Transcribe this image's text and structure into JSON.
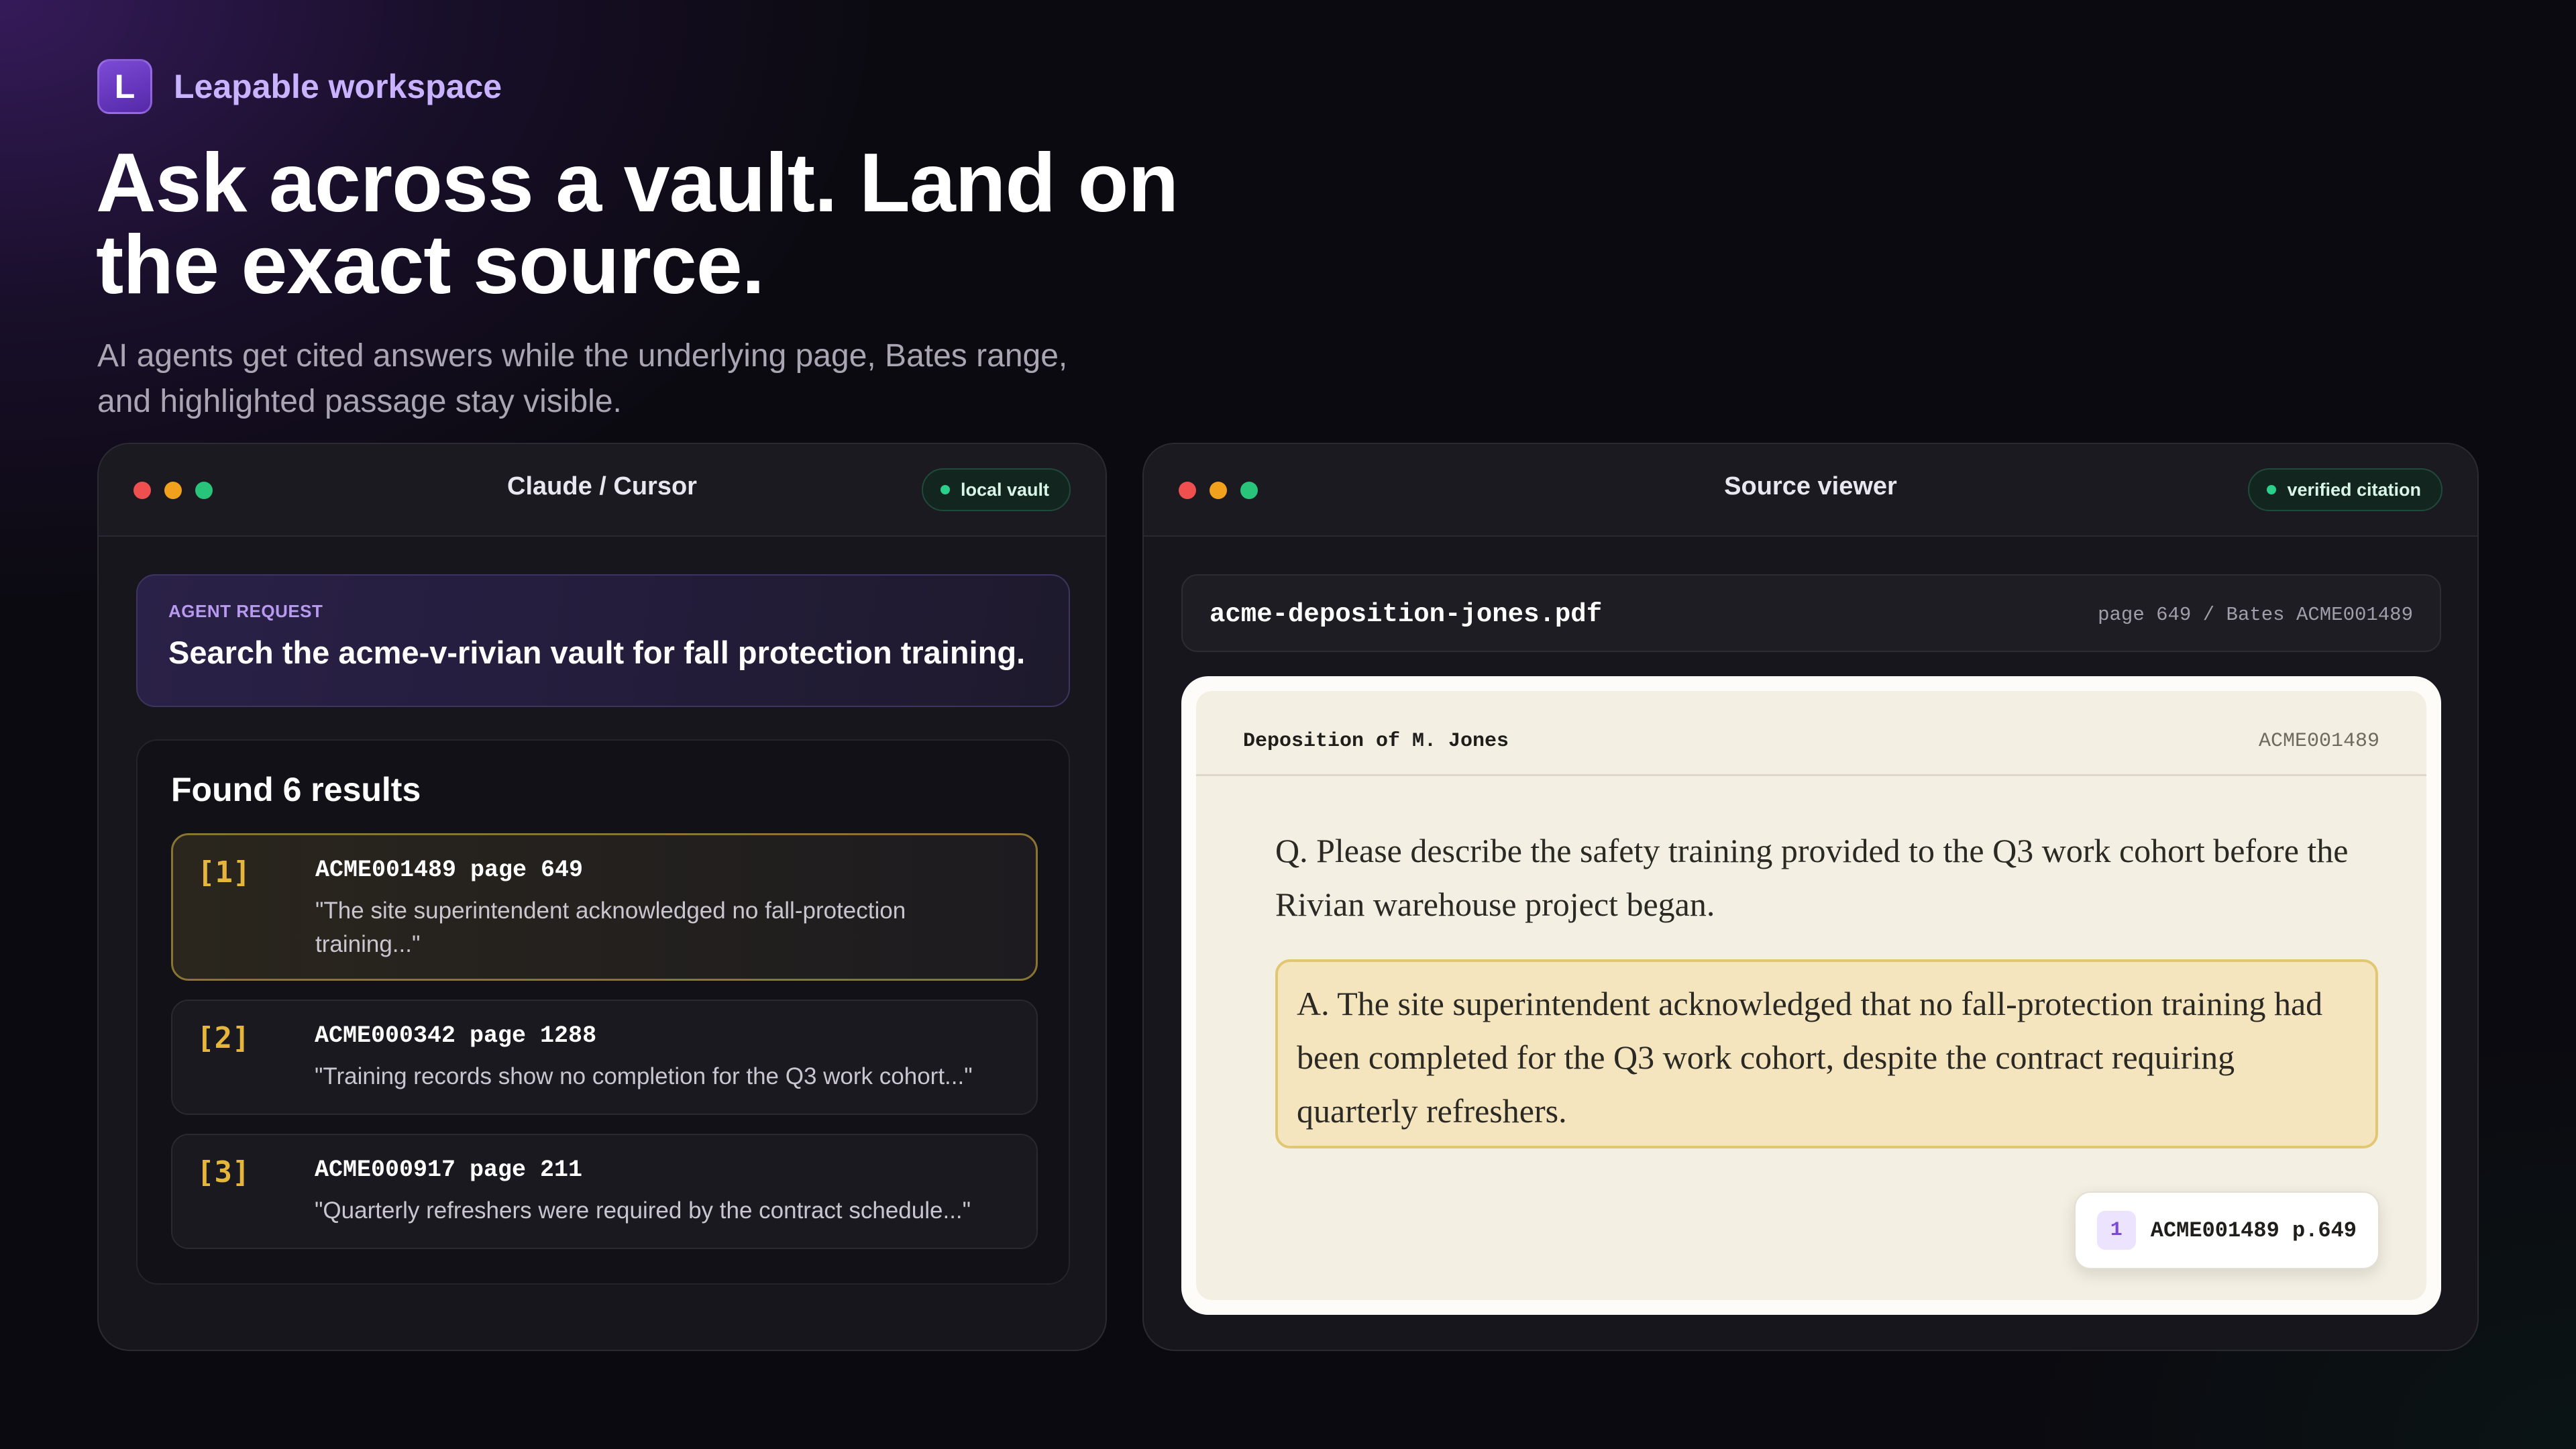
{
  "brand": {
    "logo_letter": "L",
    "name": "Leapable workspace"
  },
  "hero": {
    "headline": "Ask across a vault. Land on the exact source.",
    "subhead": "AI agents get cited answers while the underlying page, Bates range, and highlighted passage stay visible."
  },
  "left_window": {
    "title": "Claude / Cursor",
    "status_pill": "local vault",
    "request": {
      "label": "AGENT REQUEST",
      "text": "Search the acme-v-rivian vault for fall protection training."
    },
    "results": {
      "title": "Found 6 results",
      "items": [
        {
          "index": "[1]",
          "ref": "ACME001489 page 649",
          "quote": "\"The site superintendent acknowledged no fall-protection training...\"",
          "active": true
        },
        {
          "index": "[2]",
          "ref": "ACME000342 page 1288",
          "quote": "\"Training records show no completion for the Q3 work cohort...\"",
          "active": false
        },
        {
          "index": "[3]",
          "ref": "ACME000917 page 211",
          "quote": "\"Quarterly refreshers were required by the contract schedule...\"",
          "active": false
        }
      ]
    }
  },
  "right_window": {
    "title": "Source viewer",
    "status_pill": "verified citation",
    "file": {
      "name": "acme-deposition-jones.pdf",
      "meta": "page 649 / Bates ACME001489"
    },
    "document": {
      "title": "Deposition of M. Jones",
      "bates": "ACME001489",
      "question": "Q. Please describe the safety training provided to the Q3 work cohort before the Rivian warehouse project began.",
      "answer": "A. The site superintendent acknowledged that no fall-protection training had been completed for the Q3 work cohort, despite the contract requiring quarterly refreshers.",
      "citation": {
        "number": "1",
        "ref": "ACME001489 p.649"
      }
    }
  },
  "colors": {
    "accent_purple": "#7c4bd6",
    "citation_gold": "#e6b53c",
    "highlight": "#f4e5bf",
    "status_green": "#2ad08a",
    "window_red": "#ef4f4f",
    "window_yellow": "#f2a11d",
    "window_green": "#27c47a"
  }
}
